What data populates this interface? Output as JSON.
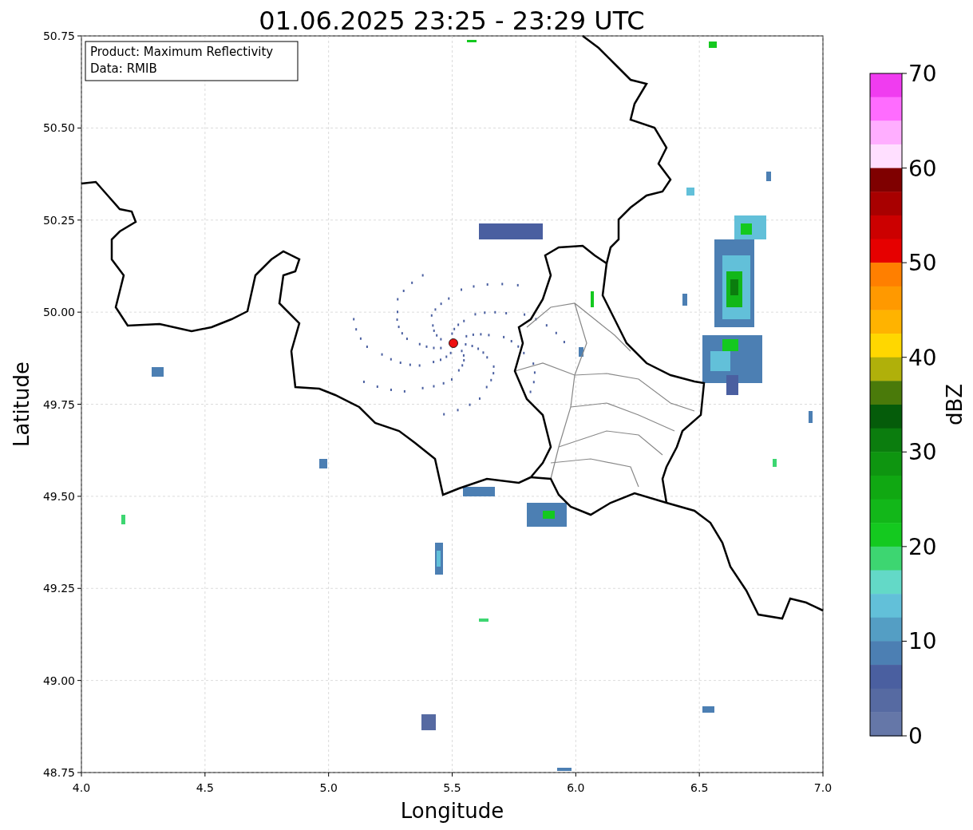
{
  "title": "01.06.2025 23:25 - 23:29 UTC",
  "annotation": [
    "Product: Maximum Reflectivity",
    "Data: RMIB"
  ],
  "axes": {
    "xlabel": "Longitude",
    "ylabel": "Latitude",
    "yticks": [
      "50.75",
      "50.50",
      "50.25",
      "50.00",
      "49.75",
      "49.50",
      "49.25",
      "49.00",
      "48.75"
    ],
    "xticks": [
      "4.0",
      "4.5",
      "5.0",
      "5.5",
      "6.0",
      "6.5",
      "7.0"
    ]
  },
  "colorbar": {
    "label": "dBZ",
    "ticks": [
      "70",
      "60",
      "50",
      "40",
      "30",
      "20",
      "10",
      "0"
    ],
    "segments": [
      {
        "color": "#f03cf0"
      },
      {
        "color": "#ff6cff"
      },
      {
        "color": "#ffaeff"
      },
      {
        "color": "#ffdfff"
      },
      {
        "color": "#7f0000"
      },
      {
        "color": "#a80000"
      },
      {
        "color": "#cc0000"
      },
      {
        "color": "#e60000"
      },
      {
        "color": "#ff7f00"
      },
      {
        "color": "#ff9900"
      },
      {
        "color": "#ffb300"
      },
      {
        "color": "#ffd700"
      },
      {
        "color": "#b0b00a"
      },
      {
        "color": "#4a7a0a"
      },
      {
        "color": "#055c0a"
      },
      {
        "color": "#0b7d0e"
      },
      {
        "color": "#0e9510"
      },
      {
        "color": "#10a812"
      },
      {
        "color": "#12b719"
      },
      {
        "color": "#14c91f"
      },
      {
        "color": "#3dd671"
      },
      {
        "color": "#63d9c7"
      },
      {
        "color": "#62c0d9"
      },
      {
        "color": "#549ec4"
      },
      {
        "color": "#4c7fb3"
      },
      {
        "color": "#4a5fa0"
      },
      {
        "color": "#566aa2"
      },
      {
        "color": "#6577a8"
      }
    ]
  }
}
